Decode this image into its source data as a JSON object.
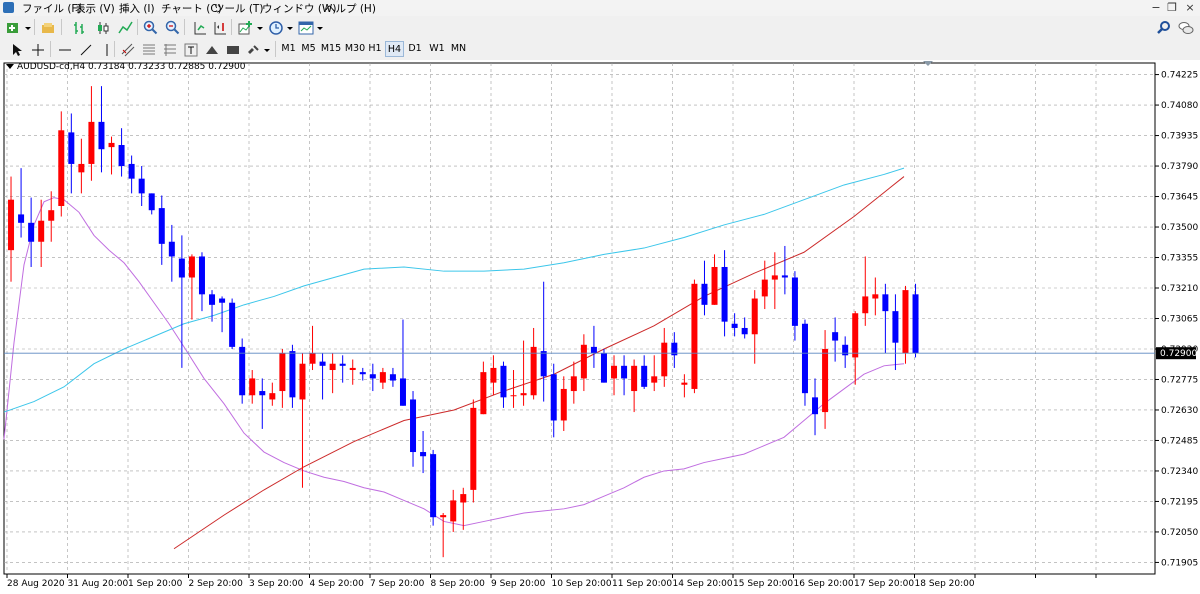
{
  "menu": {
    "items": [
      "ファイル (F)",
      "表示 (V)",
      "挿入 (I)",
      "チャート (C)",
      "ツール (T)",
      "ウィンドウ (W)",
      "ヘルプ (H)"
    ]
  },
  "toolbar": {
    "timeframes": [
      "M1",
      "M5",
      "M15",
      "M30",
      "H1",
      "H4",
      "D1",
      "W1",
      "MN"
    ],
    "active_timeframe": "H4"
  },
  "chart": {
    "header": "AUDUSD-cd,H4  0.73184 0.73233 0.72885 0.72900",
    "current_price_label": "0.72900"
  },
  "colors": {
    "bull": "#ff0000",
    "bear": "#0000ff",
    "ma_fast": "#c06ee0",
    "ma_mid": "#3cc6ea",
    "ma_slow": "#cc2a2a",
    "grid": "#a0a0a0",
    "price_line": "#5a86c0"
  },
  "chart_data": {
    "type": "candlestick",
    "symbol": "AUDUSD-cd",
    "timeframe": "H4",
    "ylim": [
      0.7185,
      0.7428
    ],
    "y_ticks": [
      "0.74225",
      "0.74080",
      "0.73935",
      "0.73790",
      "0.73645",
      "0.73500",
      "0.73355",
      "0.73210",
      "0.73065",
      "0.72920",
      "0.72775",
      "0.72630",
      "0.72485",
      "0.72340",
      "0.72195",
      "0.72050",
      "0.71905"
    ],
    "x_labels": [
      "28 Aug 2020",
      "31 Aug 20:00",
      "1 Sep 20:00",
      "2 Sep 20:00",
      "3 Sep 20:00",
      "4 Sep 20:00",
      "7 Sep 20:00",
      "8 Sep 20:00",
      "9 Sep 20:00",
      "10 Sep 20:00",
      "11 Sep 20:00",
      "14 Sep 20:00",
      "15 Sep 20:00",
      "16 Sep 20:00",
      "17 Sep 20:00",
      "18 Sep 20:00"
    ],
    "last_price": 0.729,
    "candles": [
      {
        "o": 0.7339,
        "h": 0.7374,
        "l": 0.7324,
        "c": 0.7363
      },
      {
        "o": 0.7356,
        "h": 0.7378,
        "l": 0.7345,
        "c": 0.7352
      },
      {
        "o": 0.7352,
        "h": 0.7364,
        "l": 0.7331,
        "c": 0.7343
      },
      {
        "o": 0.7343,
        "h": 0.7363,
        "l": 0.7331,
        "c": 0.7353
      },
      {
        "o": 0.7353,
        "h": 0.7367,
        "l": 0.7343,
        "c": 0.7358
      },
      {
        "o": 0.736,
        "h": 0.7405,
        "l": 0.7355,
        "c": 0.7396
      },
      {
        "o": 0.7395,
        "h": 0.7404,
        "l": 0.7366,
        "c": 0.738
      },
      {
        "o": 0.7376,
        "h": 0.7392,
        "l": 0.7366,
        "c": 0.738
      },
      {
        "o": 0.738,
        "h": 0.7417,
        "l": 0.7372,
        "c": 0.74
      },
      {
        "o": 0.74,
        "h": 0.7417,
        "l": 0.7376,
        "c": 0.7387
      },
      {
        "o": 0.7388,
        "h": 0.7393,
        "l": 0.7375,
        "c": 0.739
      },
      {
        "o": 0.7389,
        "h": 0.7397,
        "l": 0.7374,
        "c": 0.7379
      },
      {
        "o": 0.738,
        "h": 0.7384,
        "l": 0.7366,
        "c": 0.7373
      },
      {
        "o": 0.7373,
        "h": 0.7379,
        "l": 0.736,
        "c": 0.7366
      },
      {
        "o": 0.7366,
        "h": 0.7363,
        "l": 0.7356,
        "c": 0.7358
      },
      {
        "o": 0.7359,
        "h": 0.7365,
        "l": 0.7332,
        "c": 0.7342
      },
      {
        "o": 0.7343,
        "h": 0.7351,
        "l": 0.7324,
        "c": 0.7336
      },
      {
        "o": 0.7335,
        "h": 0.7346,
        "l": 0.7283,
        "c": 0.7326
      },
      {
        "o": 0.7326,
        "h": 0.7337,
        "l": 0.7306,
        "c": 0.7336
      },
      {
        "o": 0.7336,
        "h": 0.7338,
        "l": 0.731,
        "c": 0.7318
      },
      {
        "o": 0.7318,
        "h": 0.732,
        "l": 0.7305,
        "c": 0.7313
      },
      {
        "o": 0.7316,
        "h": 0.7317,
        "l": 0.73,
        "c": 0.7314
      },
      {
        "o": 0.7314,
        "h": 0.7316,
        "l": 0.7292,
        "c": 0.7293
      },
      {
        "o": 0.7293,
        "h": 0.7297,
        "l": 0.7266,
        "c": 0.727
      },
      {
        "o": 0.727,
        "h": 0.7282,
        "l": 0.7266,
        "c": 0.7278
      },
      {
        "o": 0.7272,
        "h": 0.7278,
        "l": 0.7254,
        "c": 0.727
      },
      {
        "o": 0.7268,
        "h": 0.7276,
        "l": 0.7265,
        "c": 0.7271
      },
      {
        "o": 0.7272,
        "h": 0.7292,
        "l": 0.7264,
        "c": 0.729
      },
      {
        "o": 0.7291,
        "h": 0.7294,
        "l": 0.7264,
        "c": 0.7269
      },
      {
        "o": 0.7268,
        "h": 0.729,
        "l": 0.7226,
        "c": 0.7285
      },
      {
        "o": 0.7285,
        "h": 0.7303,
        "l": 0.7282,
        "c": 0.729
      },
      {
        "o": 0.7286,
        "h": 0.729,
        "l": 0.7268,
        "c": 0.7284
      },
      {
        "o": 0.7282,
        "h": 0.729,
        "l": 0.7271,
        "c": 0.7285
      },
      {
        "o": 0.7285,
        "h": 0.7289,
        "l": 0.7276,
        "c": 0.7284
      },
      {
        "o": 0.7282,
        "h": 0.7287,
        "l": 0.7275,
        "c": 0.7283
      },
      {
        "o": 0.7281,
        "h": 0.7283,
        "l": 0.7277,
        "c": 0.728
      },
      {
        "o": 0.728,
        "h": 0.7285,
        "l": 0.7272,
        "c": 0.7278
      },
      {
        "o": 0.7276,
        "h": 0.7283,
        "l": 0.7273,
        "c": 0.7281
      },
      {
        "o": 0.728,
        "h": 0.7283,
        "l": 0.7274,
        "c": 0.7277
      },
      {
        "o": 0.7278,
        "h": 0.7306,
        "l": 0.7272,
        "c": 0.7265
      },
      {
        "o": 0.7268,
        "h": 0.7272,
        "l": 0.7236,
        "c": 0.7243
      },
      {
        "o": 0.7243,
        "h": 0.7253,
        "l": 0.7233,
        "c": 0.7241
      },
      {
        "o": 0.7242,
        "h": 0.7244,
        "l": 0.7208,
        "c": 0.7212
      },
      {
        "o": 0.7212,
        "h": 0.7214,
        "l": 0.7193,
        "c": 0.7213
      },
      {
        "o": 0.721,
        "h": 0.7225,
        "l": 0.7205,
        "c": 0.722
      },
      {
        "o": 0.7219,
        "h": 0.7226,
        "l": 0.7206,
        "c": 0.7223
      },
      {
        "o": 0.7225,
        "h": 0.7268,
        "l": 0.7219,
        "c": 0.7264
      },
      {
        "o": 0.7261,
        "h": 0.7286,
        "l": 0.7262,
        "c": 0.7281
      },
      {
        "o": 0.7276,
        "h": 0.7289,
        "l": 0.727,
        "c": 0.7283
      },
      {
        "o": 0.7284,
        "h": 0.7286,
        "l": 0.7264,
        "c": 0.7269
      },
      {
        "o": 0.727,
        "h": 0.7282,
        "l": 0.7264,
        "c": 0.727
      },
      {
        "o": 0.727,
        "h": 0.7296,
        "l": 0.7265,
        "c": 0.7271
      },
      {
        "o": 0.727,
        "h": 0.7302,
        "l": 0.7268,
        "c": 0.7293
      },
      {
        "o": 0.7291,
        "h": 0.7324,
        "l": 0.7267,
        "c": 0.7279
      },
      {
        "o": 0.728,
        "h": 0.7285,
        "l": 0.725,
        "c": 0.7258
      },
      {
        "o": 0.7258,
        "h": 0.7279,
        "l": 0.7253,
        "c": 0.7273
      },
      {
        "o": 0.7272,
        "h": 0.7286,
        "l": 0.7266,
        "c": 0.7279
      },
      {
        "o": 0.7278,
        "h": 0.7299,
        "l": 0.7272,
        "c": 0.7294
      },
      {
        "o": 0.7293,
        "h": 0.7303,
        "l": 0.7283,
        "c": 0.729
      },
      {
        "o": 0.729,
        "h": 0.7292,
        "l": 0.7276,
        "c": 0.7276
      },
      {
        "o": 0.7278,
        "h": 0.7289,
        "l": 0.727,
        "c": 0.7284
      },
      {
        "o": 0.7284,
        "h": 0.7289,
        "l": 0.727,
        "c": 0.7278
      },
      {
        "o": 0.7272,
        "h": 0.7287,
        "l": 0.7262,
        "c": 0.7284
      },
      {
        "o": 0.7284,
        "h": 0.7289,
        "l": 0.7273,
        "c": 0.7274
      },
      {
        "o": 0.7276,
        "h": 0.7289,
        "l": 0.7272,
        "c": 0.7279
      },
      {
        "o": 0.7279,
        "h": 0.7302,
        "l": 0.7274,
        "c": 0.7295
      },
      {
        "o": 0.7295,
        "h": 0.73,
        "l": 0.7283,
        "c": 0.7289
      },
      {
        "o": 0.7275,
        "h": 0.728,
        "l": 0.7269,
        "c": 0.7276
      },
      {
        "o": 0.7273,
        "h": 0.7325,
        "l": 0.7271,
        "c": 0.7323
      },
      {
        "o": 0.7323,
        "h": 0.7334,
        "l": 0.7308,
        "c": 0.7313
      },
      {
        "o": 0.7313,
        "h": 0.7337,
        "l": 0.7315,
        "c": 0.7331
      },
      {
        "o": 0.7331,
        "h": 0.7339,
        "l": 0.7298,
        "c": 0.7305
      },
      {
        "o": 0.7304,
        "h": 0.7309,
        "l": 0.7298,
        "c": 0.7302
      },
      {
        "o": 0.7302,
        "h": 0.7307,
        "l": 0.7297,
        "c": 0.7299
      },
      {
        "o": 0.7299,
        "h": 0.732,
        "l": 0.7285,
        "c": 0.7316
      },
      {
        "o": 0.7317,
        "h": 0.7334,
        "l": 0.7311,
        "c": 0.7325
      },
      {
        "o": 0.7325,
        "h": 0.7338,
        "l": 0.7311,
        "c": 0.7327
      },
      {
        "o": 0.7327,
        "h": 0.7341,
        "l": 0.7318,
        "c": 0.7326
      },
      {
        "o": 0.7326,
        "h": 0.7329,
        "l": 0.7296,
        "c": 0.7303
      },
      {
        "o": 0.7304,
        "h": 0.7306,
        "l": 0.7265,
        "c": 0.7271
      },
      {
        "o": 0.7269,
        "h": 0.7278,
        "l": 0.7251,
        "c": 0.7261
      },
      {
        "o": 0.7262,
        "h": 0.7301,
        "l": 0.7254,
        "c": 0.7292
      },
      {
        "o": 0.73,
        "h": 0.7307,
        "l": 0.7286,
        "c": 0.7296
      },
      {
        "o": 0.7294,
        "h": 0.7298,
        "l": 0.7283,
        "c": 0.7289
      },
      {
        "o": 0.7288,
        "h": 0.731,
        "l": 0.7275,
        "c": 0.7309
      },
      {
        "o": 0.7309,
        "h": 0.7336,
        "l": 0.7303,
        "c": 0.7317
      },
      {
        "o": 0.7316,
        "h": 0.7326,
        "l": 0.7308,
        "c": 0.7318
      },
      {
        "o": 0.7318,
        "h": 0.7323,
        "l": 0.729,
        "c": 0.731
      },
      {
        "o": 0.731,
        "h": 0.7318,
        "l": 0.7282,
        "c": 0.7295
      },
      {
        "o": 0.729,
        "h": 0.7322,
        "l": 0.7285,
        "c": 0.732
      },
      {
        "o": 0.7318,
        "h": 0.7323,
        "l": 0.7288,
        "c": 0.729
      }
    ],
    "series": [
      {
        "type": "line",
        "values": [
          [
            0,
            0.7249
          ],
          [
            10,
            0.7295
          ],
          [
            20,
            0.7332
          ],
          [
            30,
            0.7351
          ],
          [
            40,
            0.7362
          ],
          [
            50,
            0.7364
          ],
          [
            60,
            0.7363
          ],
          [
            75,
            0.7357
          ],
          [
            90,
            0.7346
          ],
          [
            105,
            0.7339
          ],
          [
            120,
            0.7333
          ],
          [
            135,
            0.7324
          ],
          [
            150,
            0.7314
          ],
          [
            165,
            0.7304
          ],
          [
            180,
            0.7293
          ],
          [
            200,
            0.7278
          ],
          [
            220,
            0.7266
          ],
          [
            240,
            0.7252
          ],
          [
            260,
            0.7243
          ],
          [
            280,
            0.7238
          ],
          [
            300,
            0.7234
          ],
          [
            320,
            0.7231
          ],
          [
            340,
            0.7229
          ],
          [
            360,
            0.7226
          ],
          [
            380,
            0.7224
          ],
          [
            400,
            0.722
          ],
          [
            420,
            0.7216
          ],
          [
            440,
            0.721
          ],
          [
            460,
            0.7208
          ],
          [
            480,
            0.721
          ],
          [
            500,
            0.7212
          ],
          [
            520,
            0.7214
          ],
          [
            540,
            0.7215
          ],
          [
            560,
            0.7216
          ],
          [
            580,
            0.7218
          ],
          [
            600,
            0.7222
          ],
          [
            620,
            0.7226
          ],
          [
            640,
            0.7231
          ],
          [
            660,
            0.7234
          ],
          [
            680,
            0.7235
          ],
          [
            700,
            0.7238
          ],
          [
            720,
            0.724
          ],
          [
            740,
            0.7242
          ],
          [
            760,
            0.7246
          ],
          [
            780,
            0.725
          ],
          [
            800,
            0.7258
          ],
          [
            820,
            0.7266
          ],
          [
            840,
            0.7273
          ],
          [
            860,
            0.728
          ],
          [
            880,
            0.7284
          ],
          [
            900,
            0.7285
          ]
        ]
      },
      {
        "type": "line",
        "values": [
          [
            0,
            0.7262
          ],
          [
            30,
            0.7267
          ],
          [
            60,
            0.7274
          ],
          [
            90,
            0.7285
          ],
          [
            120,
            0.7292
          ],
          [
            150,
            0.7298
          ],
          [
            180,
            0.7304
          ],
          [
            210,
            0.7308
          ],
          [
            240,
            0.7313
          ],
          [
            270,
            0.7317
          ],
          [
            300,
            0.7322
          ],
          [
            330,
            0.7326
          ],
          [
            360,
            0.733
          ],
          [
            400,
            0.7331
          ],
          [
            440,
            0.7329
          ],
          [
            480,
            0.7329
          ],
          [
            520,
            0.733
          ],
          [
            560,
            0.7333
          ],
          [
            600,
            0.7337
          ],
          [
            640,
            0.734
          ],
          [
            680,
            0.7345
          ],
          [
            720,
            0.7351
          ],
          [
            760,
            0.7356
          ],
          [
            800,
            0.7363
          ],
          [
            840,
            0.737
          ],
          [
            880,
            0.7375
          ],
          [
            900,
            0.7378
          ]
        ]
      },
      {
        "type": "line",
        "values": [
          [
            170,
            0.7197
          ],
          [
            220,
            0.7213
          ],
          [
            260,
            0.7225
          ],
          [
            300,
            0.7236
          ],
          [
            350,
            0.7248
          ],
          [
            400,
            0.7258
          ],
          [
            450,
            0.7263
          ],
          [
            500,
            0.7272
          ],
          [
            550,
            0.728
          ],
          [
            600,
            0.7292
          ],
          [
            650,
            0.7303
          ],
          [
            700,
            0.7317
          ],
          [
            750,
            0.7328
          ],
          [
            800,
            0.7338
          ],
          [
            850,
            0.7355
          ],
          [
            900,
            0.7374
          ]
        ]
      }
    ]
  }
}
